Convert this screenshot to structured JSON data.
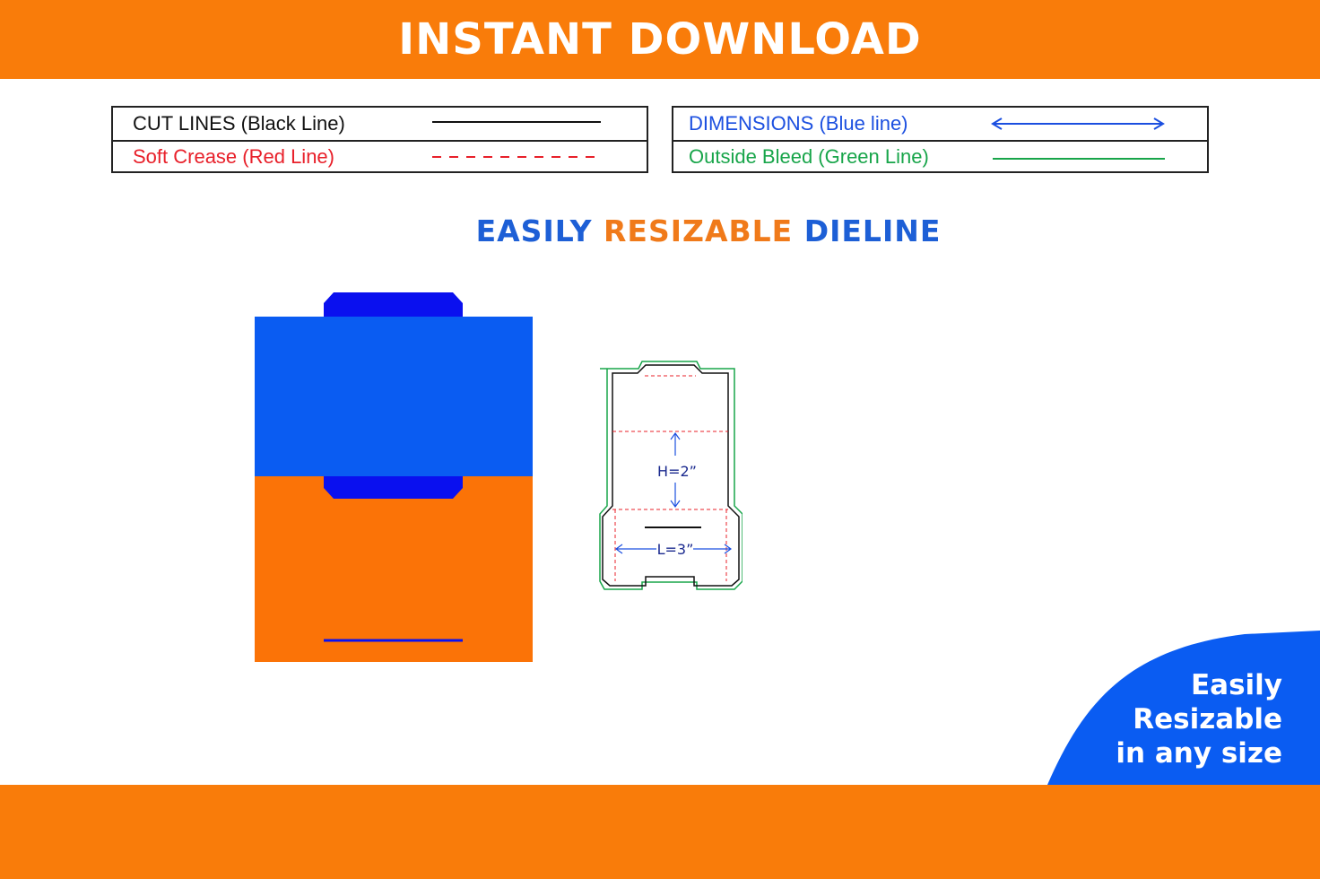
{
  "banner": {
    "title": "INSTANT DOWNLOAD"
  },
  "legend": {
    "cut_lines": "CUT LINES (Black Line)",
    "soft_crease": "Soft Crease (Red Line)",
    "dimensions": "DIMENSIONS (Blue line)",
    "outside_bleed": "Outside Bleed (Green Line)"
  },
  "heading": {
    "part1": "EASILY",
    "part2": "RESIZABLE",
    "part3": "DIELINE"
  },
  "dieline": {
    "height_label": "H=2”",
    "length_label": "L=3”"
  },
  "badge": {
    "line1": "Easily",
    "line2": "Resizable",
    "line3": "in any size"
  },
  "colors": {
    "orange": "#f97c0a",
    "blue": "#0a5cf2",
    "dark_blue": "#0a10ef",
    "cut": "#111111",
    "crease": "#e8202a",
    "dimension": "#1b4fe0",
    "bleed": "#18a54a",
    "heading_blue": "#1d5fd6",
    "heading_orange": "#f07a1a"
  }
}
